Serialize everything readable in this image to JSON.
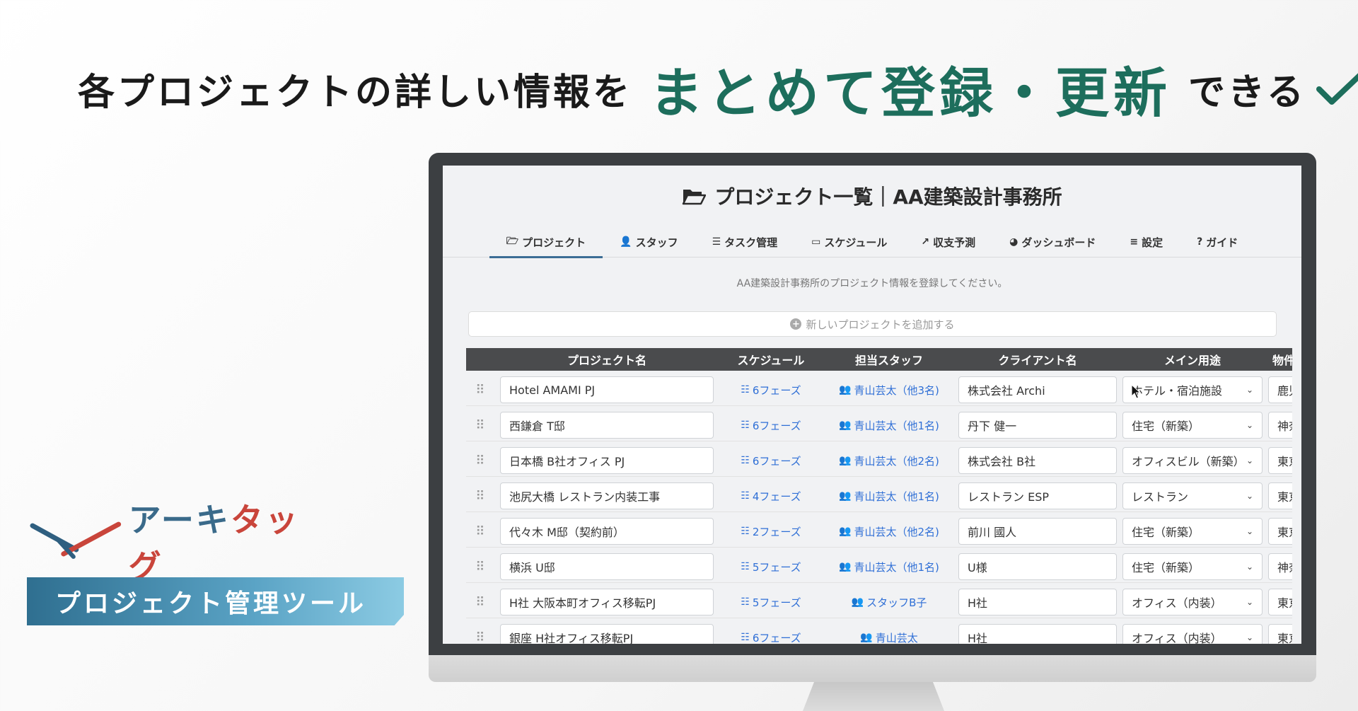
{
  "headline": {
    "part1": "各プロジェクトの詳しい情報を",
    "part2": "まとめて登録・更新",
    "part3": "できる",
    "accent_color": "#1d6e5c"
  },
  "brand": {
    "name_part1": "アーキ",
    "name_part2": "タッグ",
    "tagline": "プロジェクト管理ツール",
    "color_blue": "#3a6a8a",
    "color_red": "#c9453b"
  },
  "app": {
    "title": "プロジェクト一覧｜AA建築設計事務所",
    "subtitle": "AA建築設計事務所のプロジェクト情報を登録してください。",
    "add_button": "新しいプロジェクトを追加する",
    "tabs": [
      {
        "icon": "folder-icon",
        "label": "プロジェクト",
        "active": true
      },
      {
        "icon": "users-gear-icon",
        "label": "スタッフ"
      },
      {
        "icon": "list-icon",
        "label": "タスク管理"
      },
      {
        "icon": "calendar-icon",
        "label": "スケジュール"
      },
      {
        "icon": "chart-line-icon",
        "label": "収支予測"
      },
      {
        "icon": "pie-chart-icon",
        "label": "ダッシュボード"
      },
      {
        "icon": "sliders-icon",
        "label": "設定"
      },
      {
        "icon": "question-icon",
        "label": "ガイド"
      }
    ],
    "table": {
      "columns": [
        "プロジェクト名",
        "スケジュール",
        "担当スタッフ",
        "クライアント名",
        "メイン用途",
        "物件の"
      ],
      "rows": [
        {
          "name": "Hotel AMAMI PJ",
          "schedule": "6フェーズ",
          "staff": "青山芸太（他3名)",
          "client": "株式会社 Archi",
          "use": "ホテル・宿泊施設",
          "location": "鹿児"
        },
        {
          "name": "西鎌倉 T邸",
          "schedule": "6フェーズ",
          "staff": "青山芸太（他1名)",
          "client": "丹下 健一",
          "use": "住宅（新築）",
          "location": "神奈"
        },
        {
          "name": "日本橋 B社オフィス PJ",
          "schedule": "6フェーズ",
          "staff": "青山芸太（他2名)",
          "client": "株式会社 B社",
          "use": "オフィスビル（新築）",
          "location": "東京"
        },
        {
          "name": "池尻大橋 レストラン内装工事",
          "schedule": "4フェーズ",
          "staff": "青山芸太（他1名)",
          "client": "レストラン ESP",
          "use": "レストラン",
          "location": "東京"
        },
        {
          "name": "代々木 M邸（契約前）",
          "schedule": "2フェーズ",
          "staff": "青山芸太（他2名)",
          "client": "前川 國人",
          "use": "住宅（新築）",
          "location": "東京"
        },
        {
          "name": "横浜 U邸",
          "schedule": "5フェーズ",
          "staff": "青山芸太（他1名)",
          "client": "U様",
          "use": "住宅（新築）",
          "location": "神奈"
        },
        {
          "name": "H社 大阪本町オフィス移転PJ",
          "schedule": "5フェーズ",
          "staff": "スタッフB子",
          "client": "H社",
          "use": "オフィス（内装）",
          "location": "東京"
        },
        {
          "name": "銀座 H社オフィス移転PJ",
          "schedule": "6フェーズ",
          "staff": "青山芸太",
          "client": "H社",
          "use": "オフィス（内装）",
          "location": "東京"
        }
      ]
    }
  }
}
